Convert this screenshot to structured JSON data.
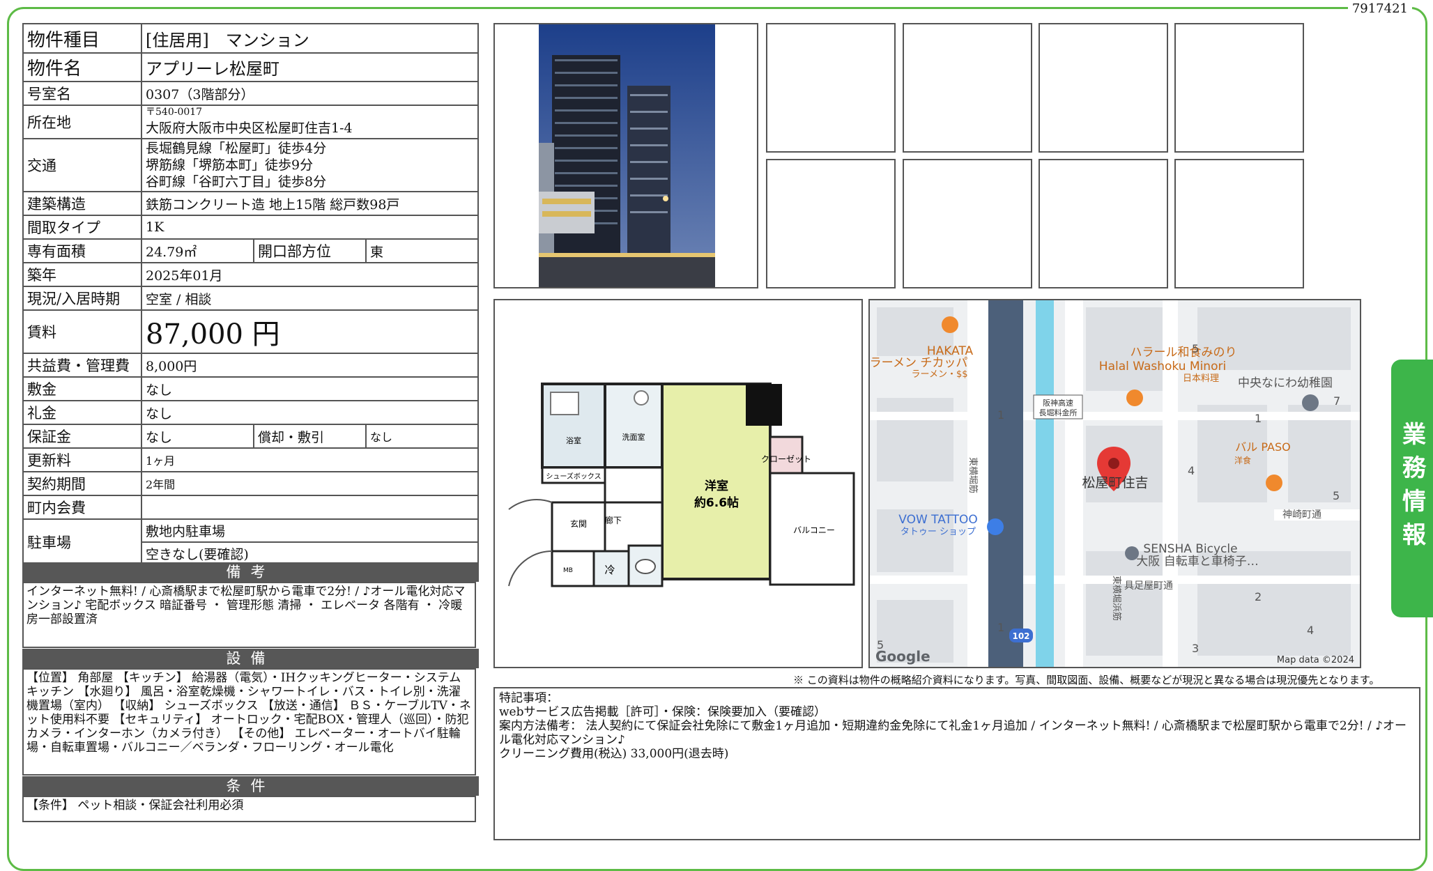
{
  "doc_id": "7917421",
  "side_tab": "業務情報",
  "table": {
    "type_label": "物件種目",
    "type_value": "[住居用]　マンション",
    "name_label": "物件名",
    "name_value": "アプリーレ松屋町",
    "room_label": "号室名",
    "room_value": "0307（3階部分）",
    "address_label": "所在地",
    "postal": "〒540-0017",
    "address_value": "大阪府大阪市中央区松屋町住吉1-4",
    "transit_label": "交通",
    "transit_1": "長堀鶴見線「松屋町」徒歩4分",
    "transit_2": "堺筋線「堺筋本町」徒歩9分",
    "transit_3": "谷町線「谷町六丁目」徒歩8分",
    "structure_label": "建築構造",
    "structure_value": "鉄筋コンクリート造 地上15階 総戸数98戸",
    "layout_label": "間取タイプ",
    "layout_value": "1K",
    "area_label": "専有面積",
    "area_value": "24.79㎡",
    "direction_label": "開口部方位",
    "direction_value": "東",
    "built_label": "築年",
    "built_value": "2025年01月",
    "status_label": "現況/入居時期",
    "status_value": "空室 / 相談",
    "rent_label": "賃料",
    "rent_value": "87,000 円",
    "fee_label": "共益費・管理費",
    "fee_value": "8,000円",
    "deposit_label": "敷金",
    "deposit_value": "なし",
    "key_label": "礼金",
    "key_value": "なし",
    "guarantee_label": "保証金",
    "guarantee_value": "なし",
    "amort_label": "償却・敷引",
    "amort_value": "なし",
    "renew_label": "更新料",
    "renew_value": "1ヶ月",
    "contract_label": "契約期間",
    "contract_value": "2年間",
    "town_label": "町内会費",
    "town_value": "",
    "parking_label": "駐車場",
    "parking_1": "敷地内駐車場",
    "parking_2": "空きなし(要確認)"
  },
  "sections": {
    "remarks_title": "備考",
    "remarks_text": "インターネット無料! / 心斎橋駅まで松屋町駅から電車で2分! / ♪オール電化対応マンション♪ 宅配ボックス 暗証番号 ・ 管理形態 清掃 ・ エレベータ 各階有 ・ 冷暖房一部設置済",
    "equip_title": "設備",
    "equip_text": "【位置】 角部屋 【キッチン】 給湯器（電気）・IHクッキングヒーター・システムキッチン 【水廻り】 風呂・浴室乾燥機・シャワートイレ・バス・トイレ別・洗濯機置場（室内） 【収納】 シューズボックス 【放送・通信】 ＢＳ・ケーブルTV・ネット使用料不要 【セキュリティ】 オートロック・宅配BOX・管理人（巡回）・防犯カメラ・インターホン（カメラ付き） 【その他】 エレベーター・オートバイ駐輪場・自転車置場・バルコニー／ベランダ・フローリング・オール電化",
    "cond_title": "条件",
    "cond_text": "【条件】 ペット相談・保証会社利用必須"
  },
  "floorplan": {
    "room": "洋室",
    "room_size": "約6.6帖",
    "closet": "クローゼット",
    "balcony": "バルコニー",
    "bath": "浴室",
    "wash": "洗面室",
    "shoes": "シューズボックス",
    "entry": "玄関",
    "hall": "廊下",
    "fridge": "冷",
    "mb": "MB"
  },
  "map": {
    "labels": [
      "HAKATA",
      "ラーメン チカッパ",
      "ラーメン・$$",
      "ハラール和食みのり",
      "Halal Washoku Minori",
      "日本料理",
      "中央なにわ幼稚園",
      "阪神高速",
      "長堀料金所",
      "松屋町住吉",
      "バル PASO",
      "洋食",
      "神崎町通",
      "VOW TATTOO",
      "タトゥー ショップ",
      "SENSHA Bicycle",
      "大阪 自転車と車椅子…",
      "具足屋町通",
      "東横堀筋",
      "東横堀浜筋"
    ],
    "numbers": [
      "5",
      "1",
      "7",
      "1",
      "4",
      "5",
      "2",
      "1",
      "4",
      "3",
      "5"
    ],
    "route": "102",
    "logo": "Google",
    "credit": "Map data ©2024"
  },
  "note": "※ この資料は物件の概略紹介資料になります。写真、間取図面、設備、概要などが現況と異なる場合は現況優先となります。",
  "special": {
    "title": "特記事項：",
    "line1": "webサービス広告掲載［許可］・保険：保険要加入（要確認）",
    "line2": "案内方法備考： 法人契約にて保証会社免除にて敷金1ヶ月追加・短期違約金免除にて礼金1ヶ月追加 / インターネット無料! / 心斎橋駅まで松屋町駅から電車で2分! / ♪オール電化対応マンション♪",
    "line3": "クリーニング費用(税込) 33,000円(退去時)"
  }
}
